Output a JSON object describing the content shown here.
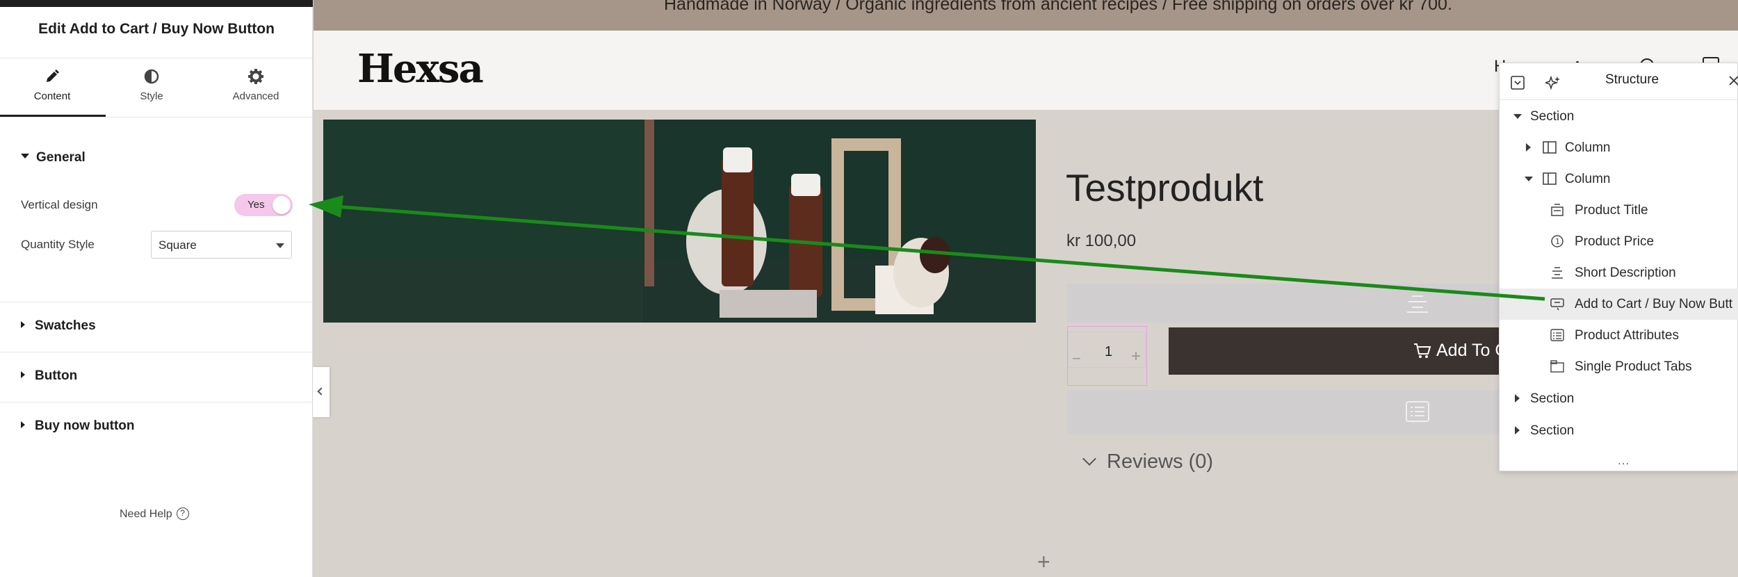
{
  "panel": {
    "title": "Edit Add to Cart / Buy Now Button",
    "tabs": [
      {
        "label": "Content",
        "icon": "pencil-icon"
      },
      {
        "label": "Style",
        "icon": "half-circle-icon"
      },
      {
        "label": "Advanced",
        "icon": "gear-icon"
      }
    ],
    "general": {
      "heading": "General",
      "vertical_design_label": "Vertical design",
      "vertical_design_value": "Yes",
      "quantity_style_label": "Quantity Style",
      "quantity_style_value": "Square"
    },
    "sections": [
      "Swatches",
      "Button",
      "Buy now button"
    ],
    "need_help": "Need Help",
    "help_icon_text": "?"
  },
  "site": {
    "announcement": "Handmade in Norway / Organic ingredients from ancient recipes / Free shipping on orders over kr 700.",
    "logo": "Hexsa",
    "nav_partial": "H",
    "product": {
      "title": "Testprodukt",
      "price": "kr 100,00",
      "quantity": "1",
      "qty_minus": "−",
      "qty_plus": "+",
      "add_to_cart": "Add To C",
      "reviews": "Reviews (0)"
    },
    "add_section": "+"
  },
  "structure": {
    "title": "Structure",
    "items": [
      {
        "label": "Section"
      },
      {
        "label": "Column"
      },
      {
        "label": "Column"
      },
      {
        "label": "Product Title"
      },
      {
        "label": "Product Price"
      },
      {
        "label": "Short Description"
      },
      {
        "label": "Add to Cart / Buy Now Butt"
      },
      {
        "label": "Product Attributes"
      },
      {
        "label": "Single Product Tabs"
      },
      {
        "label": "Section"
      },
      {
        "label": "Section"
      }
    ],
    "more": "..."
  },
  "colors": {
    "toggle_on": "#f5c7ea",
    "arrow": "#1a8a1a",
    "cart_button": "#3a3330",
    "announcement_bg": "#a59689"
  }
}
